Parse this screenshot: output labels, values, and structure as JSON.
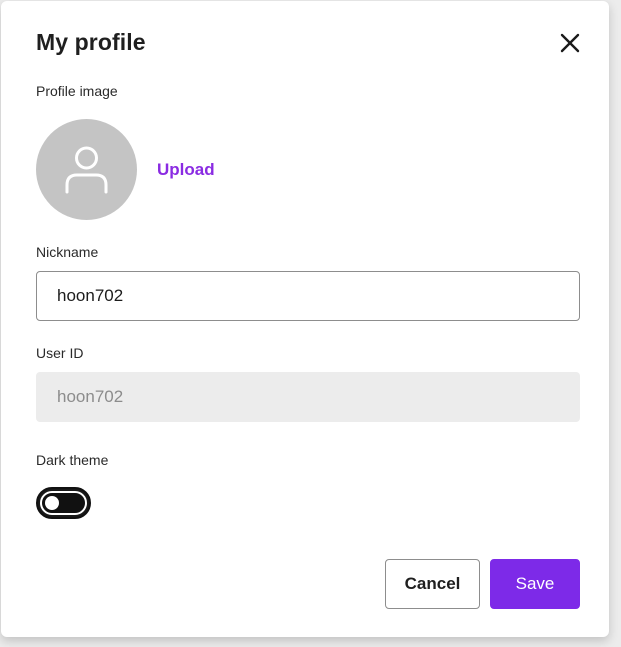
{
  "dialog": {
    "title": "My profile",
    "close_icon": "close-icon"
  },
  "profile_image": {
    "label": "Profile image",
    "avatar_icon": "user-icon",
    "upload_label": "Upload"
  },
  "nickname": {
    "label": "Nickname",
    "value": "hoon702"
  },
  "user_id": {
    "label": "User ID",
    "value": "hoon702"
  },
  "dark_theme": {
    "label": "Dark theme",
    "enabled": false
  },
  "actions": {
    "cancel_label": "Cancel",
    "save_label": "Save"
  },
  "colors": {
    "accent": "#7d2ae8",
    "link": "#8a2be2",
    "avatar_bg": "#c4c4c4",
    "disabled_field_bg": "#ececec"
  }
}
